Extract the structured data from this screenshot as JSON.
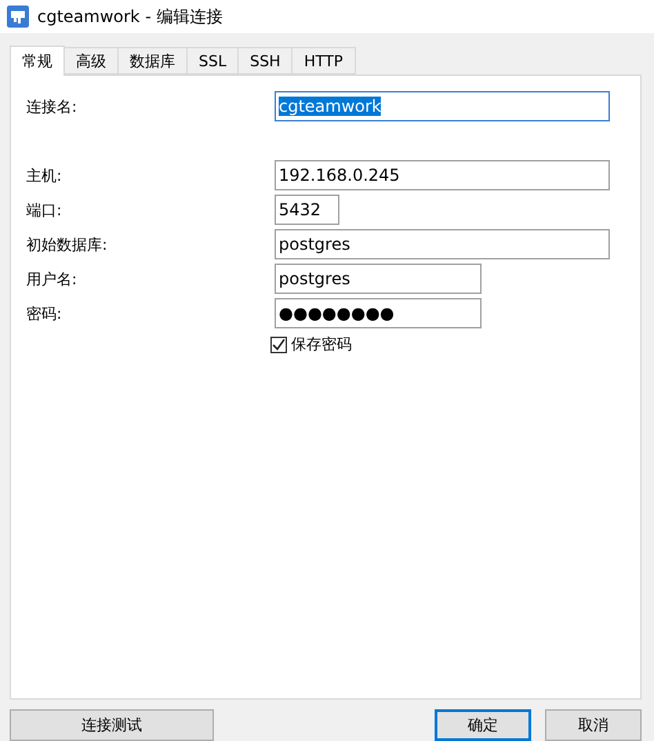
{
  "window": {
    "title": "cgteamwork - 编辑连接"
  },
  "tabs": [
    {
      "label": "常规",
      "selected": true
    },
    {
      "label": "高级",
      "selected": false
    },
    {
      "label": "数据库",
      "selected": false
    },
    {
      "label": "SSL",
      "selected": false
    },
    {
      "label": "SSH",
      "selected": false
    },
    {
      "label": "HTTP",
      "selected": false
    }
  ],
  "fields": [
    {
      "label": "连接名:",
      "value": "cgteamwork",
      "focused": true
    },
    {
      "label": "主机:",
      "value": "192.168.0.245",
      "focused": false
    },
    {
      "label": "端口:",
      "value": "5432",
      "focused": false
    },
    {
      "label": "初始数据库:",
      "value": "postgres",
      "focused": false
    },
    {
      "label": "用户名:",
      "value": "postgres",
      "focused": false
    },
    {
      "label": "密码:",
      "value": "●●●●●●●●",
      "focused": false
    }
  ],
  "save_password": {
    "label": "保存密码",
    "checked": true
  },
  "buttons": [
    {
      "label": "连接测试",
      "default": false
    },
    {
      "label": "确定",
      "default": true
    },
    {
      "label": "取消",
      "default": false
    }
  ]
}
